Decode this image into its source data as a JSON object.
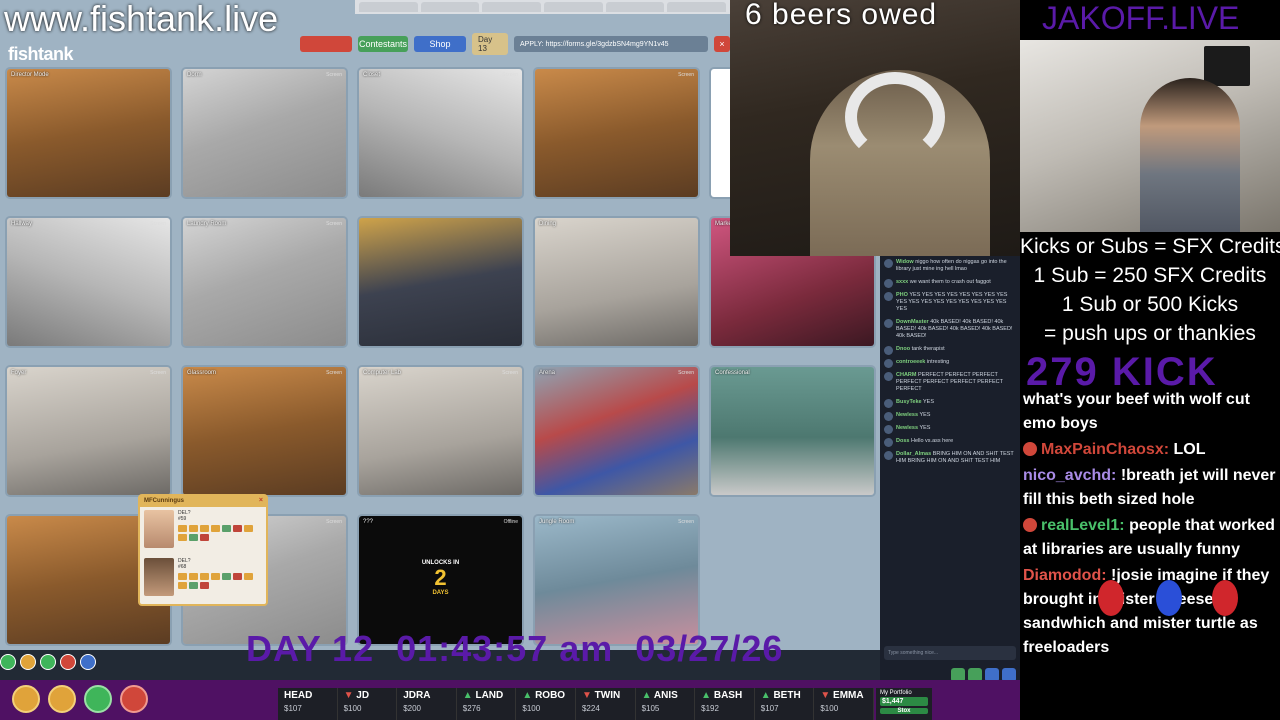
{
  "overlay": {
    "site_url": "www.fishtank.live",
    "beers_owed": "6 beers owed",
    "streamer_site": "JAKOFF.LIVE",
    "date_line": {
      "day": "DAY 12",
      "time": "01:43:57 am",
      "date": "03/27/26"
    }
  },
  "fishtank": {
    "logo": "fishtank",
    "toolbar": {
      "btn_red": "",
      "btn_contestants": "Contestants",
      "btn_shop": "Shop",
      "day_label": "Day 13",
      "url_text": "APPLY: https://forms.gle/3gdzbSN4mg9YN1v45"
    },
    "cams": [
      {
        "label": "Director Mode",
        "badge": "",
        "style": "warm"
      },
      {
        "label": "Dorm",
        "badge": "Screen",
        "style": "gray"
      },
      {
        "label": "Closet",
        "badge": "Screen",
        "style": "gray2"
      },
      {
        "label": "",
        "badge": "Screen",
        "style": "warm"
      },
      {
        "label": "",
        "badge": "",
        "style": "bars"
      },
      {
        "label": "Hallway",
        "badge": "Screen",
        "style": "gray2"
      },
      {
        "label": "Laundry Room",
        "badge": "Screen",
        "style": "gray"
      },
      {
        "label": "",
        "badge": "",
        "style": "couch"
      },
      {
        "label": "Dining",
        "badge": "",
        "style": "lab"
      },
      {
        "label": "Market",
        "badge": "Screen",
        "style": "pink"
      },
      {
        "label": "Foyer",
        "badge": "Screen",
        "style": "lab"
      },
      {
        "label": "Glassroom",
        "badge": "Screen",
        "style": "warm"
      },
      {
        "label": "Computer Lab",
        "badge": "Screen",
        "style": "lab"
      },
      {
        "label": "Arena",
        "badge": "Screen",
        "style": "mat"
      },
      {
        "label": "Confessional",
        "badge": "",
        "style": "aqua"
      },
      {
        "label": "",
        "badge": "",
        "style": "warm"
      },
      {
        "label": "West Wing",
        "badge": "Screen",
        "style": "gray"
      },
      {
        "label": "???",
        "badge": "Offline",
        "style": "dark"
      },
      {
        "label": "Jungle Room",
        "badge": "Screen",
        "style": "kids"
      }
    ],
    "unlocks": {
      "line1": "UNLOCKS IN",
      "number": "2",
      "line2": "DAYS"
    },
    "popup": {
      "title": "MFCunningus",
      "rows": [
        {
          "name": "DEL?",
          "stat": "#59"
        },
        {
          "name": "DEL?",
          "stat": "#68"
        }
      ]
    },
    "chat": [
      {
        "user": "Widow",
        "text": "niggo how often do niggas go into the library just mine ing hell lmao"
      },
      {
        "user": "sxxx",
        "text": "we want them to crash out faggot"
      },
      {
        "user": "PHO",
        "text": "YES YES YES YES YES YES YES YES YES YES YES YES YES YES YES YES YES YES"
      },
      {
        "user": "DownMaster",
        "text": "40k BASED! 40k BASED! 40k BASED! 40k BASED! 40k BASED! 40k BASED! 40k BASED!"
      },
      {
        "user": "Dnoo",
        "text": "tank therapist"
      },
      {
        "user": "controeeek",
        "text": "intresting"
      },
      {
        "user": "CHARM",
        "text": "PERFECT PERFECT PERFECT PERFECT PERFECT PERFECT PERFECT PERFECT"
      },
      {
        "user": "BusyTeke",
        "text": "YES"
      },
      {
        "user": "Newless",
        "text": "YES"
      },
      {
        "user": "Newless",
        "text": "YES"
      },
      {
        "user": "Doss",
        "text": "Hello vs.ass here"
      },
      {
        "user": "Dollar_Almas",
        "text": "BRING HIM ON AND SHIT TEST HIM BRING HIM ON AND SHIT TEST HIM"
      }
    ],
    "chat_placeholder": "Type something nice..."
  },
  "sfx": {
    "lines": [
      "Kicks or Subs = SFX Credits",
      "1 Sub = 250 SFX Credits",
      "1 Sub or 500 Kicks",
      "= push ups or thankies"
    ],
    "kick_count": "279 KICK"
  },
  "chat": [
    {
      "user": "",
      "text": "what's your beef with wolf cut emo boys",
      "user_color": "#ffffff",
      "dot": false
    },
    {
      "user": "MaxPainChaosx:",
      "text": "LOL",
      "user_color": "#d0473a",
      "dot": true
    },
    {
      "user": "nico_avchd:",
      "text": "!breath jet will never fill this beth sized hole",
      "user_color": "#a98be6",
      "dot": false
    },
    {
      "user": "realLevel1:",
      "text": "people that worked at libraries are usually funny",
      "user_color": "#49c06a",
      "dot": true
    },
    {
      "user": "Diamodod:",
      "text": "!josie imagine if they brought in mister cheese sandwhich and mister turtle as freeloaders",
      "user_color": "#e0534a",
      "dot": false
    }
  ],
  "ticker": [
    {
      "symbol": "HEAD",
      "dir": "",
      "price": "$107"
    },
    {
      "symbol": "JD",
      "dir": "down",
      "price": "$100"
    },
    {
      "symbol": "JDRA",
      "dir": "",
      "price": "$200"
    },
    {
      "symbol": "LAND",
      "dir": "up",
      "price": "$276"
    },
    {
      "symbol": "ROBO",
      "dir": "up",
      "price": "$100"
    },
    {
      "symbol": "TWIN",
      "dir": "down",
      "price": "$224"
    },
    {
      "symbol": "ANIS",
      "dir": "up",
      "price": "$105"
    },
    {
      "symbol": "BASH",
      "dir": "up",
      "price": "$192"
    },
    {
      "symbol": "BETH",
      "dir": "up",
      "price": "$107"
    },
    {
      "symbol": "EMMA",
      "dir": "down",
      "price": "$100"
    }
  ],
  "portfolio": {
    "label": "My Portfolio",
    "value": "$1,447",
    "button": "Stox"
  }
}
